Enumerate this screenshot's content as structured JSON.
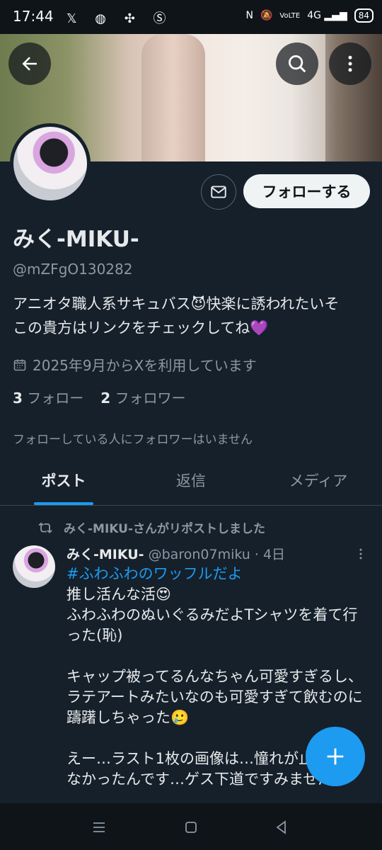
{
  "status_bar": {
    "time": "17:44",
    "left_icons": [
      "x-icon",
      "cat-icon",
      "pinwheel-icon",
      "s-icon"
    ],
    "right_text": [
      "N",
      "VoLTE",
      "4G"
    ],
    "battery": "84"
  },
  "profile": {
    "name": "みく-MIKU-",
    "handle": "@mZFgO130282",
    "bio_line1": "アニオタ職人系サキュバス😈快楽に誘われたいそ",
    "bio_line2": "この貴方はリンクをチェックしてね💜",
    "joined": "2025年9月からXを利用しています",
    "following_count": "3",
    "following_label": "フォロー",
    "followers_count": "2",
    "followers_label": "フォロワー",
    "no_followers_note": "フォローしている人にフォロワーはいません",
    "follow_button": "フォローする"
  },
  "tabs": [
    {
      "label": "ポスト",
      "active": true
    },
    {
      "label": "返信",
      "active": false
    },
    {
      "label": "メディア",
      "active": false
    }
  ],
  "tweet": {
    "repost_note": "みく-MIKU-さんがリポストしました",
    "author_name": "みく-MIKU-",
    "author_handle": "@baron07miku",
    "time": "· 4日",
    "hashtag": "#ふわふわのワッフルだよ",
    "text": "推し活んな活😍\nふわふわのぬいぐるみだよTシャツを着て行った(恥)\n\nキャップ被ってるんなちゃん可愛すぎるし、ラテアートみたいなのも可愛すぎて飲むのに躊躇しちゃった🥲\n\nえー…ラスト1枚の画像は…憧れが止められなかったんです…ゲス下道ですみません…"
  },
  "colors": {
    "background": "#15202b",
    "accent": "#1d9bf0",
    "secondary_text": "#8b98a5"
  }
}
